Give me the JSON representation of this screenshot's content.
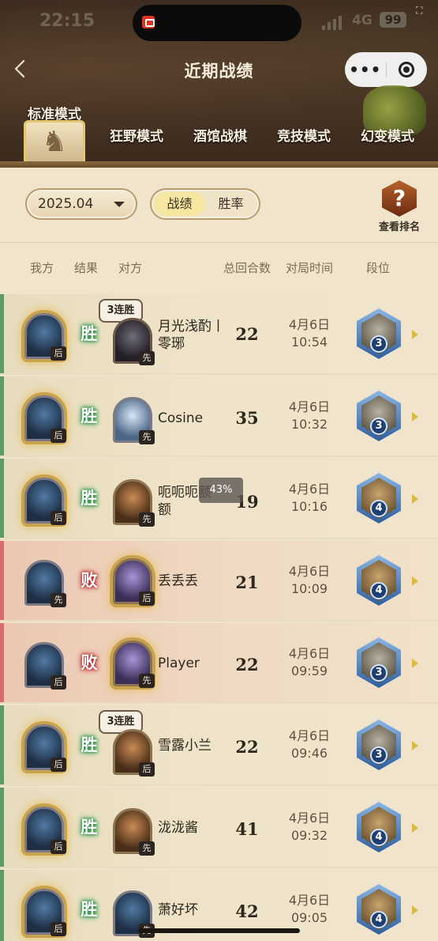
{
  "status": {
    "time": "22:15",
    "network": "4G",
    "battery": "99"
  },
  "header": {
    "title": "近期战绩"
  },
  "mode_tabs": [
    {
      "label": "标准模式",
      "active": true
    },
    {
      "label": "狂野模式",
      "active": false
    },
    {
      "label": "酒馆战棋",
      "active": false
    },
    {
      "label": "竞技模式",
      "active": false
    },
    {
      "label": "幻变模式",
      "active": false
    }
  ],
  "filters": {
    "month": "2025.04",
    "segment": [
      {
        "label": "战绩",
        "selected": true
      },
      {
        "label": "胜率",
        "selected": false
      }
    ],
    "rank_button": {
      "icon": "?",
      "label": "查看排名"
    }
  },
  "columns": [
    "我方",
    "结果",
    "对方",
    "总回合数",
    "对局时间",
    "段位"
  ],
  "matches": [
    {
      "result": "胜",
      "my_order": "后",
      "opp_order": "先",
      "opponent": "月光浅酌丨零琊",
      "turns": "22",
      "date": "4月6日",
      "time": "10:54",
      "rank": "3",
      "streak": "3连胜"
    },
    {
      "result": "胜",
      "my_order": "后",
      "opp_order": "先",
      "opponent": "Cosine",
      "turns": "35",
      "date": "4月6日",
      "time": "10:32",
      "rank": "3",
      "streak": ""
    },
    {
      "result": "胜",
      "my_order": "后",
      "opp_order": "先",
      "opponent": "呃呃呃额额",
      "turns": "19",
      "date": "4月6日",
      "time": "10:16",
      "rank": "4",
      "streak": ""
    },
    {
      "result": "败",
      "my_order": "先",
      "opp_order": "后",
      "opponent": "丢丢丢",
      "turns": "21",
      "date": "4月6日",
      "time": "10:09",
      "rank": "4",
      "streak": ""
    },
    {
      "result": "败",
      "my_order": "后",
      "opp_order": "先",
      "opponent": "Player",
      "turns": "22",
      "date": "4月6日",
      "time": "09:59",
      "rank": "3",
      "streak": ""
    },
    {
      "result": "胜",
      "my_order": "后",
      "opp_order": "后",
      "opponent": "雪露小兰",
      "turns": "22",
      "date": "4月6日",
      "time": "09:46",
      "rank": "3",
      "streak": "3连胜"
    },
    {
      "result": "胜",
      "my_order": "后",
      "opp_order": "先",
      "opponent": "泷泷酱",
      "turns": "41",
      "date": "4月6日",
      "time": "09:32",
      "rank": "4",
      "streak": ""
    },
    {
      "result": "胜",
      "my_order": "后",
      "opp_order": "先",
      "opponent": "萧好坏",
      "turns": "42",
      "date": "4月6日",
      "time": "09:05",
      "rank": "4",
      "streak": ""
    }
  ],
  "toast": "43%",
  "colors": {
    "win": "#5f9a66",
    "loss": "#d86c6c",
    "accent": "#f6e7a0"
  }
}
